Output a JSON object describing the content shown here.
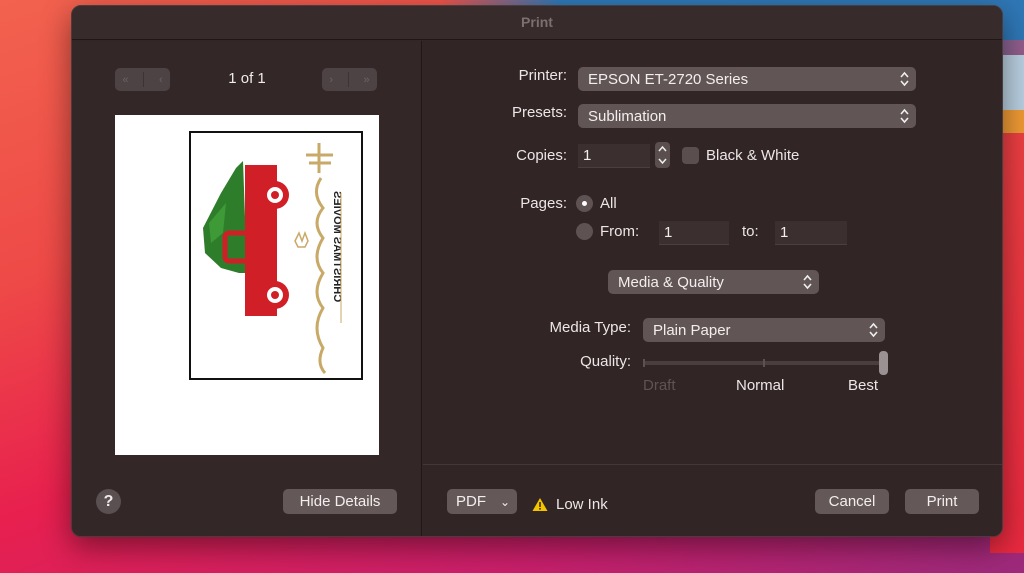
{
  "window": {
    "title": "Print"
  },
  "preview": {
    "page_counter": "1 of 1",
    "nav": {
      "first_icon": "«",
      "prev_icon": "‹",
      "next_icon": "›",
      "last_icon": "»"
    },
    "image_text": "CHRISTMAS MOVIES"
  },
  "left_footer": {
    "help_label": "?",
    "hide_details_label": "Hide Details"
  },
  "form": {
    "printer": {
      "label": "Printer:",
      "value": "EPSON ET-2720 Series"
    },
    "presets": {
      "label": "Presets:",
      "value": "Sublimation"
    },
    "copies": {
      "label": "Copies:",
      "value": "1"
    },
    "black_white": {
      "label": "Black & White",
      "checked": false
    },
    "pages": {
      "label": "Pages:",
      "all_label": "All",
      "all_selected": true,
      "from_label": "From:",
      "from_value": "1",
      "to_label": "to:",
      "to_value": "1"
    },
    "section_popup": {
      "value": "Media & Quality"
    },
    "media_type": {
      "label": "Media Type:",
      "value": "Plain Paper"
    },
    "quality": {
      "label": "Quality:",
      "options": [
        "Draft",
        "Normal",
        "Best"
      ],
      "selected": "Best",
      "position_fraction": 1.0
    }
  },
  "footer": {
    "pdf_label": "PDF",
    "pdf_chevron": "⌄",
    "warning_text": "Low Ink",
    "cancel_label": "Cancel",
    "print_label": "Print"
  },
  "colors": {
    "dialog_bg": "#322627",
    "control_bg": "#625556",
    "warning": "#f5c400",
    "truck_red": "#d01f26",
    "tree_green": "#2e7d2a",
    "gold": "#c9a968"
  }
}
